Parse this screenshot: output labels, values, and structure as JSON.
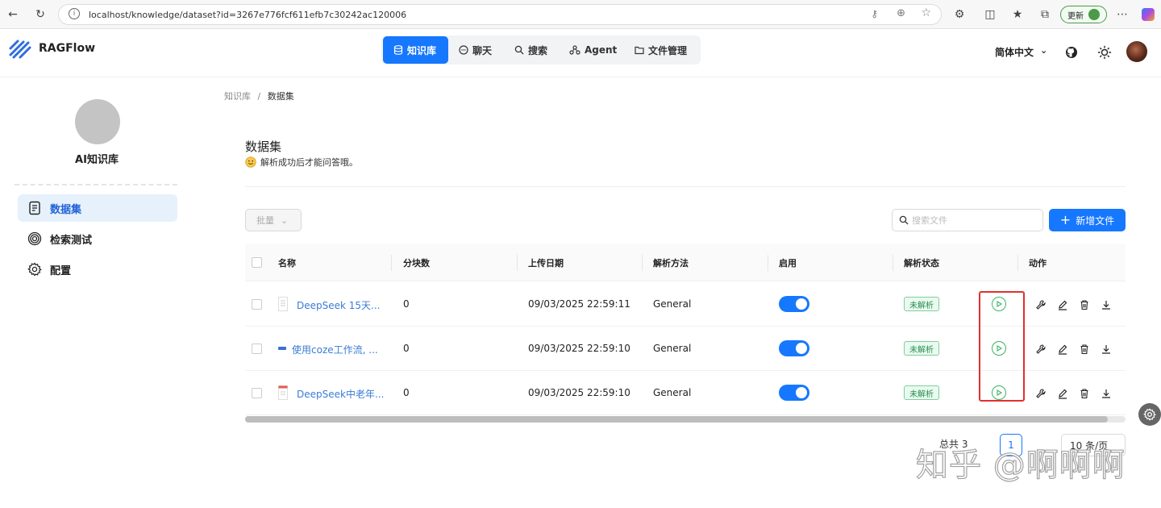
{
  "browser": {
    "url": "localhost/knowledge/dataset?id=3267e776fcf611efb7c30242ac120006",
    "update_label": "更新"
  },
  "app": {
    "brand": "RAGFlow",
    "nav": [
      {
        "label": "知识库",
        "icon": "database-icon",
        "active": true
      },
      {
        "label": "聊天",
        "icon": "chat-icon",
        "active": false
      },
      {
        "label": "搜索",
        "icon": "search-icon",
        "active": false
      },
      {
        "label": "Agent",
        "icon": "agent-icon",
        "active": false
      },
      {
        "label": "文件管理",
        "icon": "folder-icon",
        "active": false
      }
    ],
    "language": "简体中文"
  },
  "sidebar": {
    "kb_name": "AI知识库",
    "items": [
      {
        "label": "数据集",
        "icon": "dataset-icon",
        "active": true
      },
      {
        "label": "检索测试",
        "icon": "target-icon",
        "active": false
      },
      {
        "label": "配置",
        "icon": "gear-icon",
        "active": false
      }
    ]
  },
  "breadcrumb": {
    "root": "知识库",
    "sep": "/",
    "current": "数据集"
  },
  "page": {
    "title": "数据集",
    "subtitle": "解析成功后才能问答哦。",
    "bulk_label": "批量",
    "search_placeholder": "搜索文件",
    "add_label": "新增文件"
  },
  "table": {
    "headers": [
      "名称",
      "分块数",
      "上传日期",
      "解析方法",
      "启用",
      "解析状态",
      "动作"
    ],
    "rows": [
      {
        "name": "DeepSeek 15天...",
        "chunks": "0",
        "date": "09/03/2025 22:59:11",
        "method": "General",
        "enabled": true,
        "status": "未解析",
        "file_icon": "doc-file-icon"
      },
      {
        "name": "使用coze工作流, ...",
        "chunks": "0",
        "date": "09/03/2025 22:59:10",
        "method": "General",
        "enabled": true,
        "status": "未解析",
        "file_icon": "word-file-icon"
      },
      {
        "name": "DeepSeek中老年...",
        "chunks": "0",
        "date": "09/03/2025 22:59:10",
        "method": "General",
        "enabled": true,
        "status": "未解析",
        "file_icon": "pdf-file-icon"
      }
    ]
  },
  "pagination": {
    "total": "总共 3",
    "current": "1",
    "page_size": "10 条/页"
  },
  "watermark": "知乎 @啊啊啊",
  "colors": {
    "primary": "#1677ff",
    "success": "#3ab364",
    "highlight": "#e03030"
  }
}
